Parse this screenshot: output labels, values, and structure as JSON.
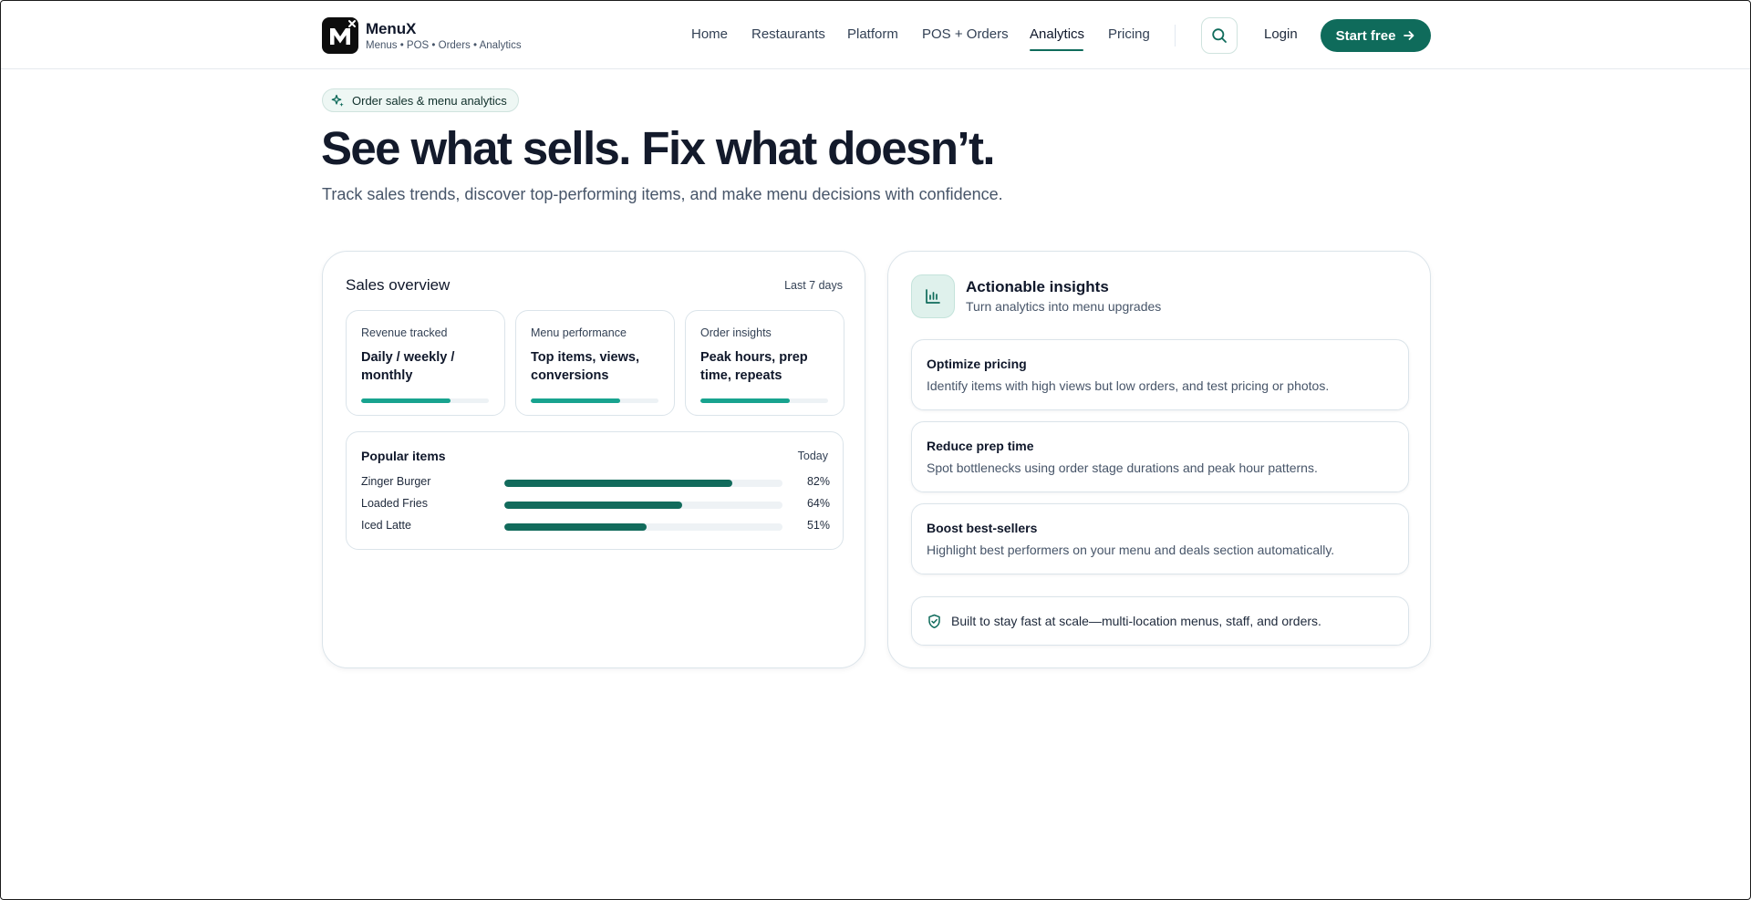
{
  "brand": {
    "name": "MenuX",
    "tagline": "Menus • POS • Orders • Analytics"
  },
  "nav": {
    "items": [
      {
        "label": "Home",
        "active": false
      },
      {
        "label": "Restaurants",
        "active": false
      },
      {
        "label": "Platform",
        "active": false
      },
      {
        "label": "POS + Orders",
        "active": false
      },
      {
        "label": "Analytics",
        "active": true
      },
      {
        "label": "Pricing",
        "active": false
      }
    ],
    "search_icon": "search-icon",
    "login": "Login",
    "cta": "Start free",
    "cta_icon": "arrow-right-icon"
  },
  "hero": {
    "badge": "Order sales & menu analytics",
    "badge_icon": "sparkle-icon",
    "title": "See what sells. Fix what doesn’t.",
    "subtitle": "Track sales trends, discover top-performing items, and make menu decisions with confidence."
  },
  "sales_overview": {
    "title": "Sales overview",
    "range": "Last 7 days",
    "metrics": [
      {
        "label": "Revenue tracked",
        "value": "Daily / weekly / monthly",
        "progress": 0.7
      },
      {
        "label": "Menu performance",
        "value": "Top items, views, conversions",
        "progress": 0.7
      },
      {
        "label": "Order insights",
        "value": "Peak hours, prep time, repeats",
        "progress": 0.7
      }
    ],
    "popular": {
      "title": "Popular items",
      "range": "Today",
      "items": [
        {
          "name": "Zinger Burger",
          "percent": 82,
          "label": "82%"
        },
        {
          "name": "Loaded Fries",
          "percent": 64,
          "label": "64%"
        },
        {
          "name": "Iced Latte",
          "percent": 51,
          "label": "51%"
        }
      ]
    }
  },
  "insights": {
    "icon": "bar-chart-icon",
    "title": "Actionable insights",
    "subtitle": "Turn analytics into menu upgrades",
    "items": [
      {
        "title": "Optimize pricing",
        "desc": "Identify items with high views but low orders, and test pricing or photos."
      },
      {
        "title": "Reduce prep time",
        "desc": "Spot bottlenecks using order stage durations and peak hour patterns."
      },
      {
        "title": "Boost best-sellers",
        "desc": "Highlight best performers on your menu and deals section automatically."
      }
    ],
    "note": "Built to stay fast at scale—multi-location menus, staff, and orders.",
    "note_icon": "shield-check-icon"
  },
  "colors": {
    "brand": "#0f6b5b",
    "accent": "#18a38f",
    "bar": "#126b5c"
  }
}
